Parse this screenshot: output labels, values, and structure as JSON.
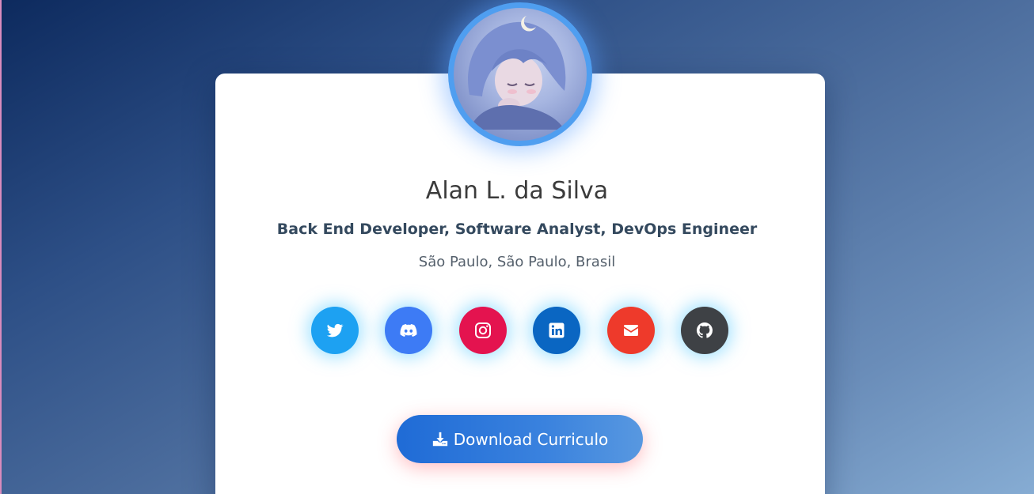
{
  "profile": {
    "name": "Alan L. da Silva",
    "roles": "Back End Developer, Software Analyst, DevOps Engineer",
    "location": "São Paulo, São Paulo, Brasil"
  },
  "social": [
    {
      "icon": "twitter-icon",
      "color": "#1da1f2"
    },
    {
      "icon": "discord-icon",
      "color": "#3d7bf5"
    },
    {
      "icon": "instagram-icon",
      "color": "#e4134f"
    },
    {
      "icon": "linkedin-icon",
      "color": "#0a66c2"
    },
    {
      "icon": "email-icon",
      "color": "#ee3a2b"
    },
    {
      "icon": "github-icon",
      "color": "#3e4145"
    }
  ],
  "download": {
    "label": "Download Curriculo",
    "icon": "download-icon"
  },
  "colors": {
    "accent": "#4f9ef0",
    "card": "#ffffff"
  }
}
